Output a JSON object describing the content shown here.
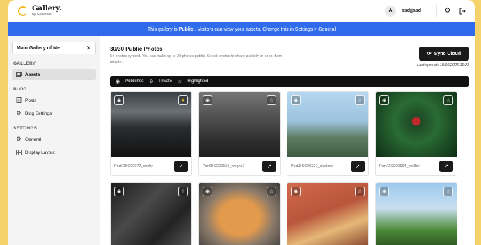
{
  "app": {
    "logo_title": "Gallery.",
    "logo_sub": "by Generate"
  },
  "user": {
    "initial": "A",
    "name": "asdjjasd"
  },
  "banner": {
    "prefix": "This gallery is",
    "status": "Public",
    "suffix": ". Visitors can view your assets. Change this in Settings > General"
  },
  "sidebar": {
    "gallery_name": "Main Gallery of Me",
    "sections": [
      {
        "title": "GALLERY",
        "items": [
          {
            "label": "Assets",
            "icon": "image-icon",
            "active": true
          }
        ]
      },
      {
        "title": "BLOG",
        "items": [
          {
            "label": "Posts",
            "icon": "document-icon"
          },
          {
            "label": "Blog Settings",
            "icon": "gear-icon"
          }
        ]
      },
      {
        "title": "SETTINGS",
        "items": [
          {
            "label": "General",
            "icon": "gear-icon"
          },
          {
            "label": "Display Layout",
            "icon": "layout-icon"
          }
        ]
      }
    ]
  },
  "main": {
    "title": "30/30 Public Photos",
    "subtitle": "54 photos synced. You can make up to 30 photos public. Select photos to share publicly or keep them private.",
    "sync_label": "Sync Cloud",
    "last_sync": "Last sync at: 18/10/2025 11:23",
    "legend": {
      "published": "Published",
      "private": "Private",
      "highlighted": "Highlighted"
    }
  },
  "photos": [
    {
      "caption": "Port/DSC00072_clrzhy",
      "highlighted": true
    },
    {
      "caption": "Port/DSC00155_whghs7",
      "highlighted": false
    },
    {
      "caption": "Port/DSC00327_ckwtme",
      "highlighted": false
    },
    {
      "caption": "Port/DSC00564_mq8bi4",
      "highlighted": false
    },
    {
      "caption": "",
      "highlighted": false
    },
    {
      "caption": "",
      "highlighted": false
    },
    {
      "caption": "",
      "highlighted": false
    },
    {
      "caption": "",
      "highlighted": false
    }
  ],
  "colors": {
    "accent_blue": "#2f6bea",
    "page_bg": "#f5d26a",
    "button_dark": "#1a1a1a",
    "highlight_star": "#f5c518"
  }
}
